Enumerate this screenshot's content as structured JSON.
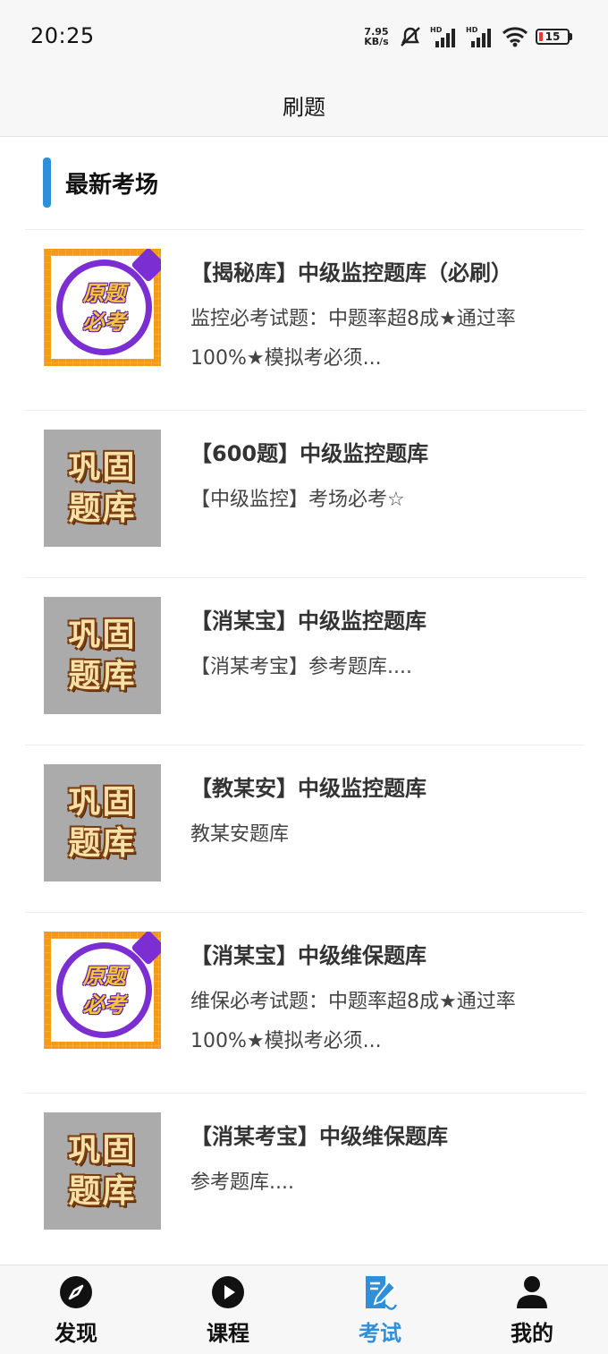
{
  "status": {
    "time": "20:25",
    "netspeed_value": "7.95",
    "netspeed_unit": "KB/s",
    "battery": "15"
  },
  "header": {
    "title": "刷题"
  },
  "section": {
    "title": "最新考场"
  },
  "thumb_text": {
    "gray_line1": "巩固",
    "gray_line2": "题库",
    "orange_line1": "原题",
    "orange_line2": "必考"
  },
  "items": [
    {
      "title": "【揭秘库】中级监控题库（必刷）",
      "desc": "监控必考试题：中题率超8成★通过率100%★模拟考必须..."
    },
    {
      "title": "【600题】中级监控题库",
      "desc": "【中级监控】考场必考☆"
    },
    {
      "title": "【消某宝】中级监控题库",
      "desc": "【消某考宝】参考题库...."
    },
    {
      "title": "【教某安】中级监控题库",
      "desc": "教某安题库"
    },
    {
      "title": "【消某宝】中级维保题库",
      "desc": "维保必考试题：中题率超8成★通过率100%★模拟考必须..."
    },
    {
      "title": "【消某考宝】中级维保题库",
      "desc": "参考题库...."
    }
  ],
  "tabs": [
    {
      "label": "发现",
      "icon": "compass-icon"
    },
    {
      "label": "课程",
      "icon": "play-icon"
    },
    {
      "label": "考试",
      "icon": "exam-edit-icon"
    },
    {
      "label": "我的",
      "icon": "user-icon"
    }
  ],
  "colors": {
    "accent": "#2f8fd8",
    "thumb_gray": "#ababab",
    "thumb_orange": "#f39a17",
    "thumb_purple": "#7b2ed1"
  }
}
